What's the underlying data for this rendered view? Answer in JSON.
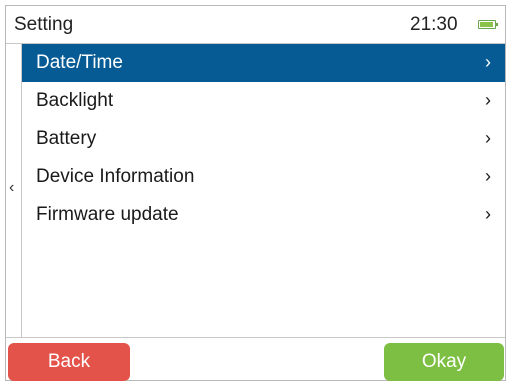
{
  "header": {
    "title": "Setting",
    "clock": "21:30",
    "battery_level": 0.9
  },
  "menu": {
    "items": [
      {
        "label": "Date/Time",
        "chevron": "›",
        "selected": true
      },
      {
        "label": "Backlight",
        "chevron": "›",
        "selected": false
      },
      {
        "label": "Battery",
        "chevron": "›",
        "selected": false
      },
      {
        "label": "Device Information",
        "chevron": "›",
        "selected": false
      },
      {
        "label": "Firmware update",
        "chevron": "›",
        "selected": false
      }
    ]
  },
  "nav": {
    "back_chevron": "‹"
  },
  "footer": {
    "back_label": "Back",
    "okay_label": "Okay"
  },
  "colors": {
    "selected_bg": "#065b95",
    "back_button": "#e4534a",
    "okay_button": "#7dbf43",
    "battery": "#8bc34a"
  },
  "icons": [
    "battery-icon",
    "chevron-right-icon",
    "chevron-left-icon"
  ]
}
